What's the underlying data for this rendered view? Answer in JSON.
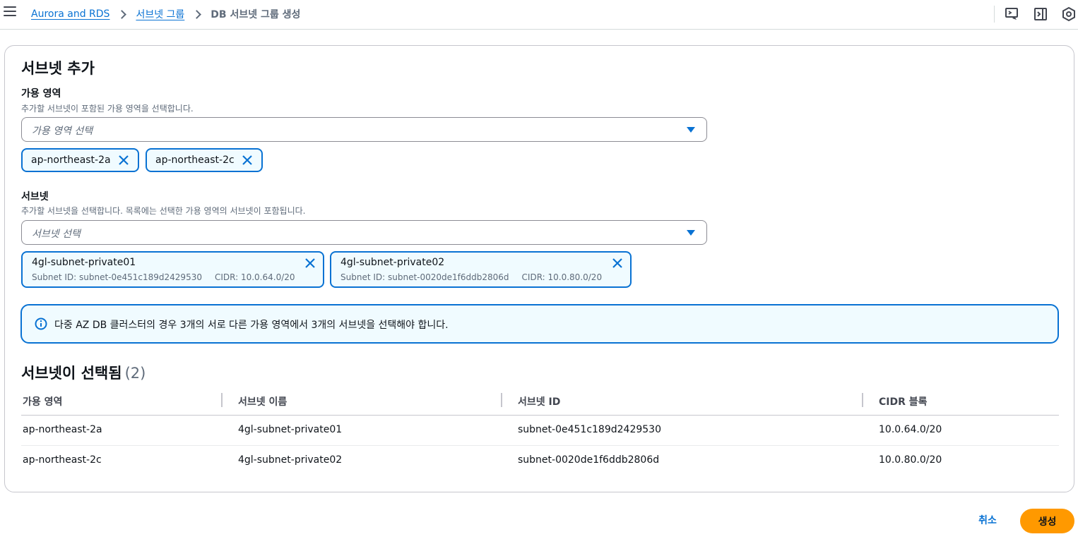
{
  "header": {
    "breadcrumbs": [
      {
        "label": "Aurora and RDS"
      },
      {
        "label": "서브넷 그룹"
      },
      {
        "label": "DB 서브넷 그룹 생성"
      }
    ],
    "icons": [
      "menu-icon",
      "cloudshell-icon",
      "notifications-panel-icon",
      "settings-icon"
    ]
  },
  "add_subnets": {
    "title": "서브넷 추가",
    "az": {
      "label": "가용 영역",
      "description": "추가할 서브넷이 포함된 가용 영역을 선택합니다.",
      "placeholder": "가용 영역 선택",
      "tokens": [
        "ap-northeast-2a",
        "ap-northeast-2c"
      ]
    },
    "subnet": {
      "label": "서브넷",
      "description": "추가할 서브넷을 선택합니다. 목록에는 선택한 가용 영역의 서브넷이 포함됩니다.",
      "placeholder": "서브넷 선택",
      "tokens": [
        {
          "name": "4gl-subnet-private01",
          "id": "Subnet ID: subnet-0e451c189d2429530",
          "cidr": "CIDR: 10.0.64.0/20"
        },
        {
          "name": "4gl-subnet-private02",
          "id": "Subnet ID: subnet-0020de1f6ddb2806d",
          "cidr": "CIDR: 10.0.80.0/20"
        }
      ]
    },
    "info": "다중 AZ DB 클러스터의 경우 3개의 서로 다른 가용 영역에서 3개의 서브넷을 선택해야 합니다."
  },
  "selected_table": {
    "title": "서브넷이 선택됨",
    "count": "(2)",
    "columns": [
      "가용 영역",
      "서브넷 이름",
      "서브넷 ID",
      "CIDR 블록"
    ],
    "rows": [
      [
        "ap-northeast-2a",
        "4gl-subnet-private01",
        "subnet-0e451c189d2429530",
        "10.0.64.0/20"
      ],
      [
        "ap-northeast-2c",
        "4gl-subnet-private02",
        "subnet-0020de1f6ddb2806d",
        "10.0.80.0/20"
      ]
    ]
  },
  "actions": {
    "cancel": "취소",
    "create": "생성"
  },
  "colors": {
    "link": "#0972d3",
    "primary_button": "#ff9900",
    "token_border": "#0972d3",
    "token_bg": "#f0fbff"
  }
}
